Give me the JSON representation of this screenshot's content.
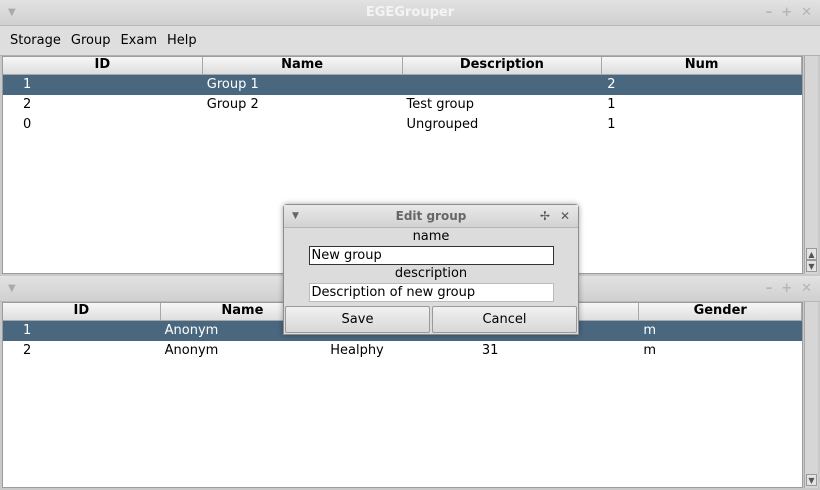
{
  "window": {
    "title": "EGEGrouper",
    "menu": [
      "Storage",
      "Group",
      "Exam",
      "Help"
    ]
  },
  "groups_table": {
    "columns": [
      "ID",
      "Name",
      "Description",
      "Num"
    ],
    "rows": [
      {
        "id": "1",
        "name": "Group 1",
        "description": "",
        "num": "2",
        "selected": true
      },
      {
        "id": "2",
        "name": "Group 2",
        "description": "Test group",
        "num": "1",
        "selected": false
      },
      {
        "id": "0",
        "name": "",
        "description": "Ungrouped",
        "num": "1",
        "selected": false
      }
    ]
  },
  "people_table": {
    "columns": [
      "ID",
      "Name",
      "",
      "",
      "Gender"
    ],
    "rows": [
      {
        "id": "1",
        "name": "Anonym",
        "col3": "",
        "col4": "",
        "gender": "m",
        "selected": true
      },
      {
        "id": "2",
        "name": "Anonym",
        "col3": "Healphy",
        "col4": "31",
        "gender": "m",
        "selected": false
      }
    ]
  },
  "dialog": {
    "title": "Edit group",
    "name_label": "name",
    "name_value": "New group",
    "description_label": "description",
    "description_value": "Description of new group",
    "save_label": "Save",
    "cancel_label": "Cancel"
  },
  "colors": {
    "selection": "#4a6780",
    "background": "#c9c9c9"
  }
}
